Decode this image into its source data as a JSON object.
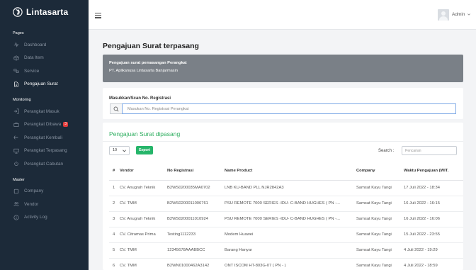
{
  "app": {
    "brand": "Lintasarta",
    "user": "Admin"
  },
  "sidebar": {
    "sections": [
      {
        "title": "Pages",
        "items": [
          {
            "label": "Dashboard",
            "icon": "activity-icon"
          },
          {
            "label": "Data Item",
            "icon": "box-icon"
          },
          {
            "label": "Service",
            "icon": "service-icon"
          },
          {
            "label": "Pengajuan Surat",
            "icon": "file-icon",
            "active": true
          }
        ]
      },
      {
        "title": "Monitoring",
        "items": [
          {
            "label": "Perangkat Masuk",
            "icon": "login-icon"
          },
          {
            "label": "Perangkat Dibawa",
            "icon": "briefcase-icon",
            "badge": "3"
          },
          {
            "label": "Perangkat Kembali",
            "icon": "return-icon"
          },
          {
            "label": "Perangkat Terpasang",
            "icon": "monitor-icon"
          },
          {
            "label": "Perangkat Cabutan",
            "icon": "unplug-icon"
          }
        ]
      },
      {
        "title": "Master",
        "items": [
          {
            "label": "Company",
            "icon": "square-icon"
          },
          {
            "label": "Vendor",
            "icon": "users-icon"
          },
          {
            "label": "Activity Log",
            "icon": "info-icon"
          }
        ]
      }
    ]
  },
  "page": {
    "title": "Pengajuan Surat terpasang",
    "banner": {
      "line1": "Pengajuan surat pemasangan Perangkat",
      "line2": "PT. Aplikanusa Lintasarta Banjarmasin"
    },
    "scan": {
      "label": "Masukkan/Scan No. Registrasi",
      "placeholder": "Masukan No. Registrasi Perangkat"
    }
  },
  "table_card": {
    "title": "Pengajuan Surat dipasang",
    "length_value": "10",
    "export_label": "Export",
    "search_label": "Search :",
    "search_placeholder": "Pencarian",
    "columns": [
      "#",
      "Vendor",
      "No Registrasi",
      "Name Product",
      "Company",
      "Waktu Pengajuan (WIT."
    ],
    "rows": [
      [
        "1",
        "CV. Anugrah Teknik",
        "B2WS0200035MA0702",
        "LNB KU-BAND PLL NJR2842A3",
        "Samsat Kayu Tangi",
        "17 Juli 2022 - 18:34"
      ],
      [
        "2",
        "CV. TMM",
        "B2WS0200011006761",
        "PSU REMOTE 7000 SERIES -IDU- C-BAND HUGHES ( PN -...",
        "Samsat Kayu Tangi",
        "16 Juli 2022 - 16:15"
      ],
      [
        "3",
        "CV. Anugrah Teknik",
        "B2WS0200011010924",
        "PSU REMOTE 7000 SERIES -IDU- C-BAND HUGHES ( PN -...",
        "Samsat Kayu Tangi",
        "16 Juli 2022 - 16:06"
      ],
      [
        "4",
        "CV. Citramas Prima",
        "Testing1112233",
        "Modem Huawei",
        "Samsat Kayu Tangi",
        "15 Juli 2022 - 23:55"
      ],
      [
        "5",
        "CV. TMM",
        "12345678AAABBCC",
        "Barang Hanyar",
        "Samsat Kayu Tangi",
        "4 Juli 2022 - 19:29"
      ],
      [
        "6",
        "CV. TMM",
        "B2WN01000462A3142",
        "ONT ISCOM HT-803G-07 ( PN - )",
        "Samsat Kayu Tangi",
        "4 Juli 2022 - 18:59"
      ]
    ]
  },
  "colors": {
    "sidebar_bg": "#1c2a39",
    "accent_green": "#2fae60",
    "export_green": "#26b56a",
    "banner_bg": "#7a8087",
    "badge_red": "#e23b3b"
  }
}
